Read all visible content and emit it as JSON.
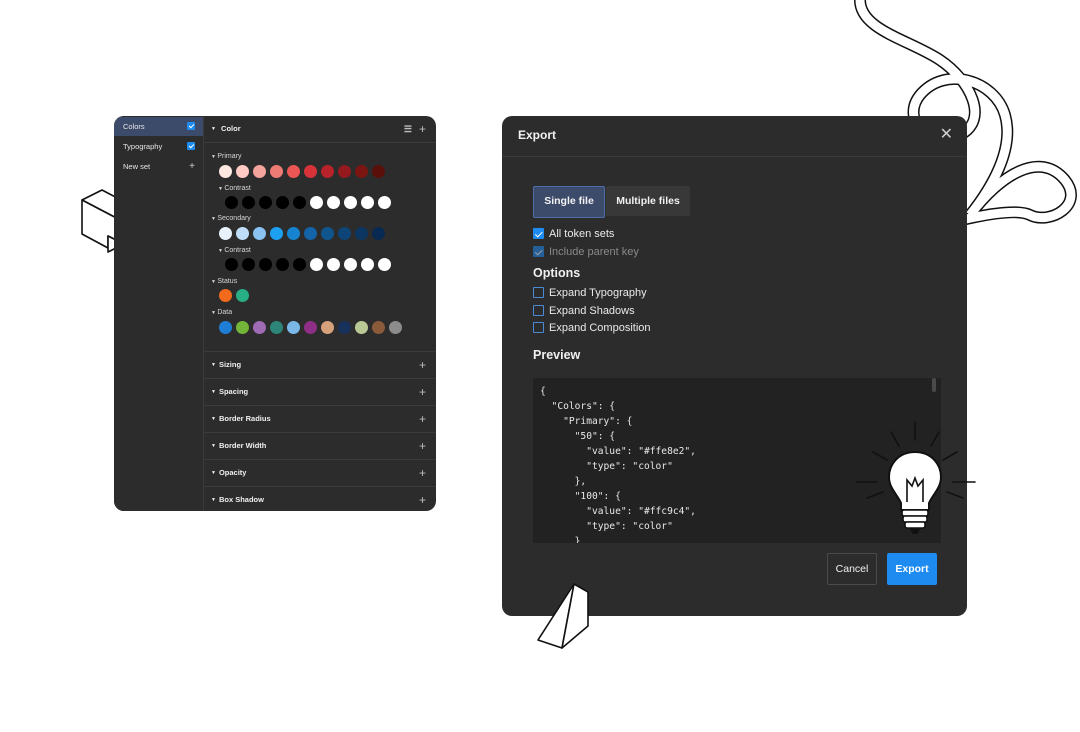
{
  "colors": {
    "accent": "#1e8bf0",
    "panel_bg": "#2c2c2c",
    "active_bg": "#3d4b6b"
  },
  "token_sets": [
    {
      "label": "Colors",
      "checked": true,
      "active": true
    },
    {
      "label": "Typography",
      "checked": true,
      "active": false
    },
    {
      "label": "New set",
      "add": true
    }
  ],
  "tokens": {
    "color_group": {
      "title": "Color",
      "primary": {
        "label": "Primary",
        "swatches": [
          "#ffe8e2",
          "#ffc9c4",
          "#f4a49c",
          "#ee7b74",
          "#ea5754",
          "#d7313a",
          "#b8232b",
          "#951a1f",
          "#7a1512",
          "#5a0f0a"
        ],
        "contrast_label": "Contrast",
        "contrast": [
          "#000000",
          "#000000",
          "#000000",
          "#000000",
          "#000000",
          "#ffffff",
          "#ffffff",
          "#ffffff",
          "#ffffff",
          "#ffffff"
        ]
      },
      "secondary": {
        "label": "Secondary",
        "swatches": [
          "#e7f2fd",
          "#bfdcf8",
          "#8ac2f2",
          "#1ea0f2",
          "#1583cf",
          "#1364a8",
          "#0f568f",
          "#0d4578",
          "#0b3662",
          "#082a52"
        ],
        "contrast_label": "Contrast",
        "contrast": [
          "#000000",
          "#000000",
          "#000000",
          "#000000",
          "#000000",
          "#ffffff",
          "#ffffff",
          "#ffffff",
          "#ffffff",
          "#ffffff"
        ]
      },
      "status": {
        "label": "Status",
        "swatches": [
          "#f26a1b",
          "#27ae84"
        ]
      },
      "data": {
        "label": "Data",
        "swatches": [
          "#1e7ed6",
          "#72b538",
          "#9f6bb5",
          "#2c8578",
          "#7ab8e8",
          "#8e2e86",
          "#d6a07a",
          "#17315c",
          "#b9c996",
          "#8a5a3a",
          "#8c8c8c"
        ]
      }
    },
    "collapsed_groups": [
      "Sizing",
      "Spacing",
      "Border Radius",
      "Border Width",
      "Opacity",
      "Box Shadow"
    ]
  },
  "export_dialog": {
    "title": "Export",
    "tabs": [
      "Single file",
      "Multiple files"
    ],
    "all_token_sets_label": "All token sets",
    "include_parent_key_label": "Include parent key",
    "options_heading": "Options",
    "options": [
      "Expand Typography",
      "Expand Shadows",
      "Expand Composition"
    ],
    "preview_heading": "Preview",
    "preview_code": "{\n  \"Colors\": {\n    \"Primary\": {\n      \"50\": {\n        \"value\": \"#ffe8e2\",\n        \"type\": \"color\"\n      },\n      \"100\": {\n        \"value\": \"#ffc9c4\",\n        \"type\": \"color\"\n      }",
    "cancel_label": "Cancel",
    "export_label": "Export"
  }
}
